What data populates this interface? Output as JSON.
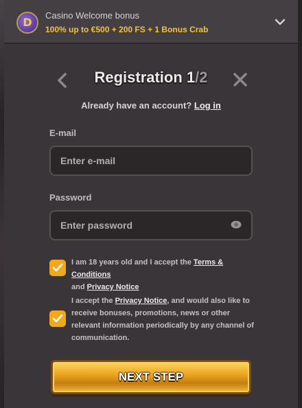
{
  "bonus": {
    "title": "Casino Welcome bonus",
    "description": "100% up to €500 + 200 FS + 1 Bonus Crab",
    "icon_letter": "D"
  },
  "registration": {
    "title_main": "Registration 1",
    "title_sep": "/",
    "title_total": "2",
    "have_account_text": "Already have an account?",
    "login_link": "Log in"
  },
  "email": {
    "label": "E-mail",
    "placeholder": "Enter e-mail"
  },
  "password": {
    "label": "Password",
    "placeholder": "Enter password"
  },
  "consents": [
    {
      "checked": true,
      "prefix": "I am 18 years old and I accept the",
      "link1": "Terms & Conditions",
      "mid": "and",
      "link2": "Privacy Notice"
    },
    {
      "checked": true,
      "prefix": "I accept the",
      "link1": "Privacy Notice",
      "suffix": ", and would also like to receive bonuses, promotions, news or other relevant information periodically by any channel of communication."
    }
  ],
  "next_button": "NEXT STEP",
  "colors": {
    "accent": "#f0a81c",
    "background": "#3a3538",
    "input_bg": "#2b2729"
  }
}
